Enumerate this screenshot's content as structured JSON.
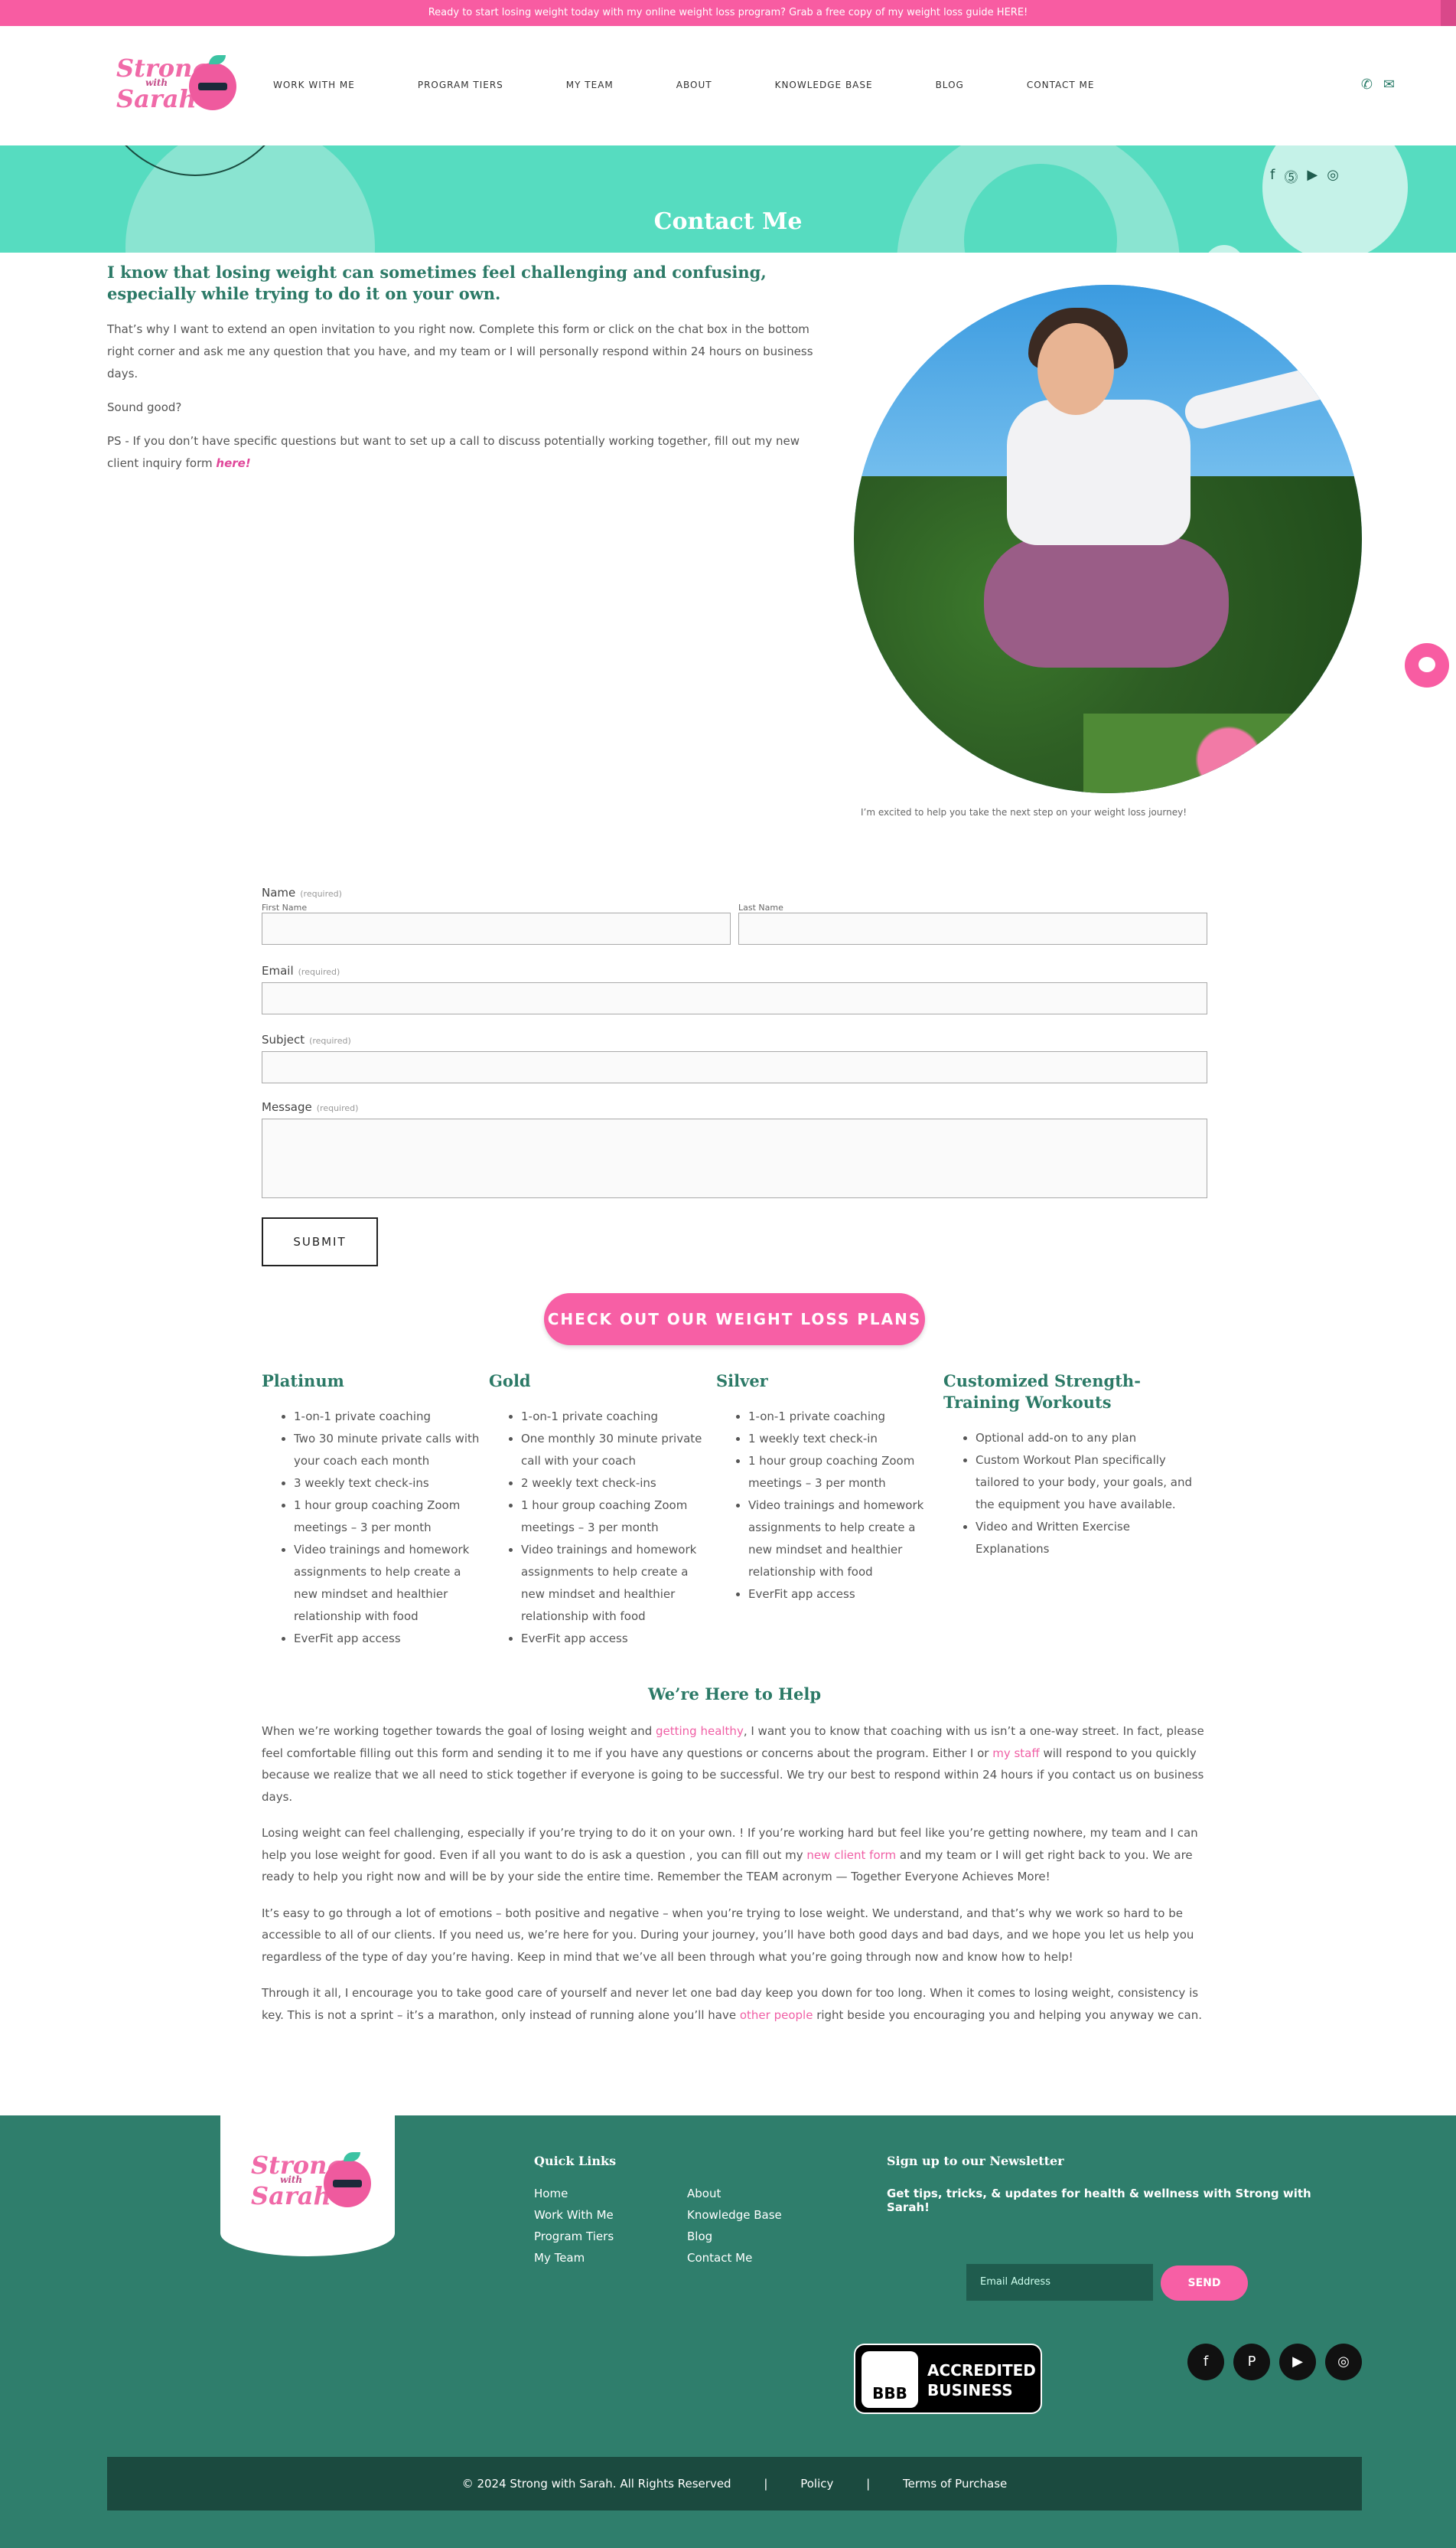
{
  "banner": {
    "text": "Ready to start losing weight today with my online weight loss program? Grab a free copy of my weight loss guide HERE!"
  },
  "logo": {
    "line1": "Strong",
    "with": "with",
    "line2": "Sarah"
  },
  "nav": [
    "WORK WITH ME",
    "PROGRAM TIERS",
    "MY TEAM",
    "ABOUT",
    "KNOWLEDGE BASE",
    "BLOG",
    "CONTACT ME"
  ],
  "header_icons": {
    "phone": "phone-icon",
    "email": "mail-icon"
  },
  "hero": {
    "title": "Contact Me",
    "social": [
      "facebook-icon",
      "pinterest-icon",
      "youtube-icon",
      "instagram-icon"
    ]
  },
  "intro": {
    "heading": "I know that losing weight can sometimes feel challenging and confusing, especially while trying to do it on your own.",
    "p1": "That’s why I want to extend an open invitation to you right now. Complete this form or click on the chat box in the bottom right corner and ask me any question that you have, and my team or I will personally respond within 24 hours on business days.",
    "p2": "Sound good?",
    "p3": "PS - If you don’t have specific questions but want to set up a call to discuss potentially working together, fill out my new client inquiry form ",
    "p3_link": "here!"
  },
  "photo_caption": "I’m excited to help you take the next step on your weight loss journey!",
  "form": {
    "name_label": "Name",
    "required": "(required)",
    "first_name": "First Name",
    "last_name": "Last Name",
    "email_label": "Email",
    "subject_label": "Subject",
    "message_label": "Message",
    "submit": "SUBMIT"
  },
  "cta": "CHECK OUT OUR WEIGHT LOSS PLANS",
  "plans": [
    {
      "title": "Platinum",
      "items": [
        "1-on-1 private coaching",
        "Two 30 minute private calls with your coach each month",
        "3 weekly text check-ins",
        "1 hour group coaching Zoom meetings – 3 per month",
        "Video trainings and homework assignments to help create a new mindset and healthier relationship with food",
        "EverFit app access"
      ]
    },
    {
      "title": "Gold",
      "items": [
        "1-on-1 private coaching",
        "One monthly 30 minute private call with your coach",
        "2 weekly text check-ins",
        "1 hour group coaching Zoom meetings – 3 per month",
        "Video trainings and homework assignments to help create a new mindset and healthier relationship with food",
        "EverFit app access"
      ]
    },
    {
      "title": "Silver",
      "items": [
        "1-on-1 private coaching",
        "1 weekly text check-in",
        "1 hour group coaching Zoom meetings – 3 per month",
        "Video trainings and homework assignments to help create a new mindset and healthier relationship with food",
        "EverFit app access"
      ]
    },
    {
      "title": "Customized Strength-Training Workouts",
      "items": [
        "Optional add-on to any plan",
        "Custom Workout Plan specifically tailored to your body, your goals, and the equipment you have available.",
        "Video and Written Exercise Explanations"
      ]
    }
  ],
  "help": {
    "title": "We’re Here to Help",
    "p1a": "When we’re working together towards the goal of losing weight and ",
    "p1_link1": "getting healthy",
    "p1b": ", I want you to know that coaching with us isn’t a one-way street. In fact, please feel comfortable filling out this form and sending it to me if you have any questions or concerns about the program. Either I or ",
    "p1_link2": "my staff",
    "p1c": " will respond to you quickly because we realize that we all need to stick together if everyone is going to be successful. We try our best to respond within 24 hours if you contact us on business days.",
    "p2a": "Losing weight can feel challenging, especially if you’re trying to do it on your own. ! If you’re working hard but feel like you’re getting nowhere, my team and I can help you lose weight for good. Even if all you want to do is ask a question , you can fill out my ",
    "p2_link": "new client form",
    "p2b": " and my team or I will get right back to you. We are ready to help you right now and will be by your side the entire time. Remember the TEAM acronym — Together Everyone Achieves More!",
    "p3": "It’s easy to go through a lot of emotions – both positive and negative – when you’re trying to lose weight. We understand, and that’s why we work so hard to be accessible to all of our clients. If you need us, we’re here for you. During your journey, you’ll have both good days and bad days, and we hope you let us help you regardless of the type of day you’re having. Keep in mind that we’ve all been through what you’re going through now and know how to help!",
    "p4a": "Through it all, I encourage you to take good care of yourself and never let one bad day keep you down for too long. When it comes to losing weight, consistency is key. This is not a sprint – it’s a marathon, only instead of running alone you’ll have ",
    "p4_link": "other people",
    "p4b": " right beside you encouraging you and helping you anyway we can."
  },
  "footer": {
    "quick_links_title": "Quick Links",
    "links": [
      "Home",
      "About",
      "Work With Me",
      "Knowledge Base",
      "Program Tiers",
      "Blog",
      "My Team",
      "Contact Me"
    ],
    "newsletter_title": "Sign up to our Newsletter",
    "newsletter_desc": "Get tips, tricks, & updates for health & wellness with Strong with Sarah!",
    "email_placeholder": "Email Address",
    "send": "SEND",
    "bbb_seal": "BBB",
    "bbb_line1": "ACCREDITED",
    "bbb_line2": "BUSINESS",
    "social": [
      "facebook-icon",
      "pinterest-icon",
      "youtube-icon",
      "instagram-icon"
    ],
    "copyright": "© 2024 Strong with Sarah. All Rights Reserved",
    "policy": "Policy",
    "terms": "Terms of Purchase",
    "separator": "|"
  },
  "colors": {
    "pink": "#f85ca2",
    "teal": "#56dcc0",
    "dark_teal": "#2f7e6c",
    "heading_green": "#2c7a67"
  }
}
